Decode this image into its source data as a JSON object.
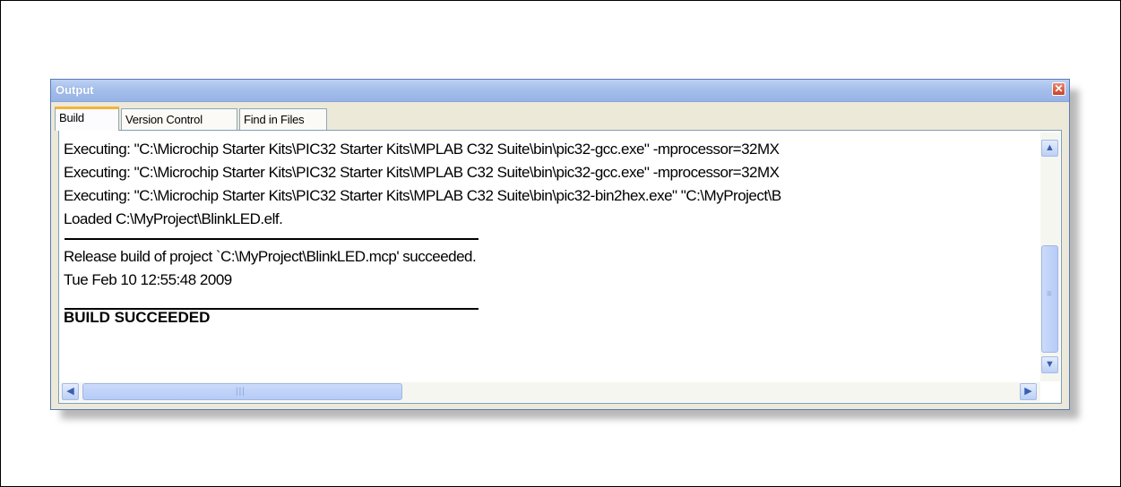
{
  "window": {
    "title": "Output",
    "close_icon": "close-icon"
  },
  "tabs": [
    {
      "label": "Build",
      "active": true
    },
    {
      "label": "Version Control",
      "active": false
    },
    {
      "label": "Find in Files",
      "active": false
    }
  ],
  "output": {
    "lines": [
      "Executing: \"C:\\Microchip Starter Kits\\PIC32 Starter Kits\\MPLAB C32 Suite\\bin\\pic32-gcc.exe\" -mprocessor=32MX",
      "Executing: \"C:\\Microchip Starter Kits\\PIC32 Starter Kits\\MPLAB C32 Suite\\bin\\pic32-gcc.exe\" -mprocessor=32MX",
      "Executing: \"C:\\Microchip Starter Kits\\PIC32 Starter Kits\\MPLAB C32 Suite\\bin\\pic32-bin2hex.exe\" \"C:\\MyProject\\B",
      "Loaded C:\\MyProject\\BlinkLED.elf.",
      "Release build of project `C:\\MyProject\\BlinkLED.mcp' succeeded.",
      "Tue Feb 10 12:55:48 2009",
      "BUILD SUCCEEDED"
    ]
  },
  "colors": {
    "titlebar": "#a5bfeb",
    "active_tab_accent": "#f3b33d",
    "close_button": "#c8442a"
  }
}
